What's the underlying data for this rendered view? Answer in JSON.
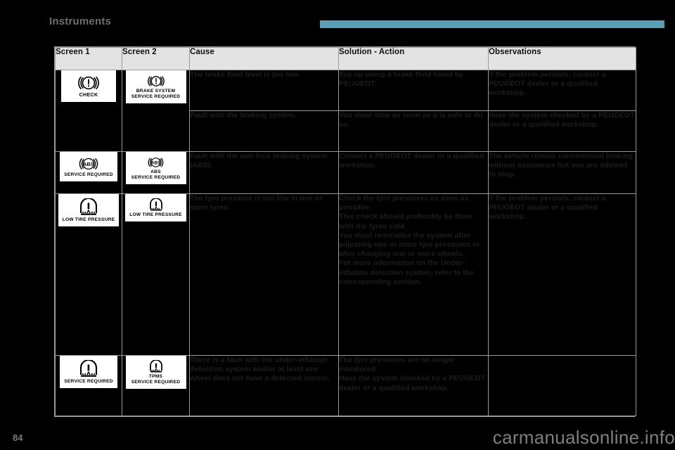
{
  "header": {
    "section_title": "Instruments",
    "rule_color": "#5a9fb5"
  },
  "table": {
    "columns": [
      "Screen 1",
      "Screen 2",
      "Cause",
      "Solution - Action",
      "Observations"
    ],
    "rows": [
      {
        "screen1": {
          "glyph": "brake-warning-icon",
          "label": "CHECK"
        },
        "screen2": {
          "glyph": "brake-warning-icon",
          "label": "BRAKE SYSTEM\nSERVICE REQUIRED"
        },
        "cause": "The brake fluid level is too low.",
        "solution": "Top up using a brake fluid listed by PEUGEOT.",
        "observations": "If the problem persists, contact a PEUGEOT dealer or a qualified workshop."
      },
      {
        "cause": "Fault with the braking system.",
        "solution": "You must stop as soon as it is safe to do so.",
        "observations": "Have the system checked by a PEUGEOT dealer or a qualified workshop."
      },
      {
        "screen1": {
          "glyph": "abs-warning-icon",
          "label": "SERVICE REQUIRED"
        },
        "screen2": {
          "glyph": "abs-warning-icon",
          "label": "ABS\nSERVICE REQUIRED"
        },
        "cause": "Fault with the anti-lock braking system (ABS).",
        "solution": "Contact a PEUGEOT dealer or a qualified workshop.",
        "observations": "The vehicle retains conventional braking without assistance but you are advised to stop."
      },
      {
        "screen1": {
          "glyph": "tyre-pressure-icon",
          "label": "LOW TIRE PRESSURE"
        },
        "screen2": {
          "glyph": "tyre-pressure-icon",
          "label": "LOW TIRE PRESSURE"
        },
        "cause": "The tyre pressure is too low in one or more tyres.",
        "solution": "Check the tyre pressures as soon as possible.\nThis check should preferably be done with the tyres cold.\nYou must reinitialise the system after adjusting one or more tyre pressures or after changing one or more wheels.\nFor more information on the Under-inflation detection system, refer to the corresponding section.",
        "observations": "If the problem persists, contact a PEUGEOT dealer or a qualified workshop."
      },
      {
        "screen1": {
          "glyph": "tyre-pressure-icon",
          "label": "SERVICE REQUIRED"
        },
        "screen2": {
          "glyph": "tyre-pressure-icon",
          "label": "TPMS\nSERVICE REQUIRED"
        },
        "cause": "There is a fault with the under-inflation detection system and/or at least one wheel does not have a detected sensor.",
        "solution": "The tyre pressures are no longer monitored.\nHave the system checked by a PEUGEOT dealer or a qualified workshop.",
        "observations": ""
      }
    ]
  },
  "footer": {
    "page_number": "84",
    "watermark": "carmanualsonline.info"
  }
}
